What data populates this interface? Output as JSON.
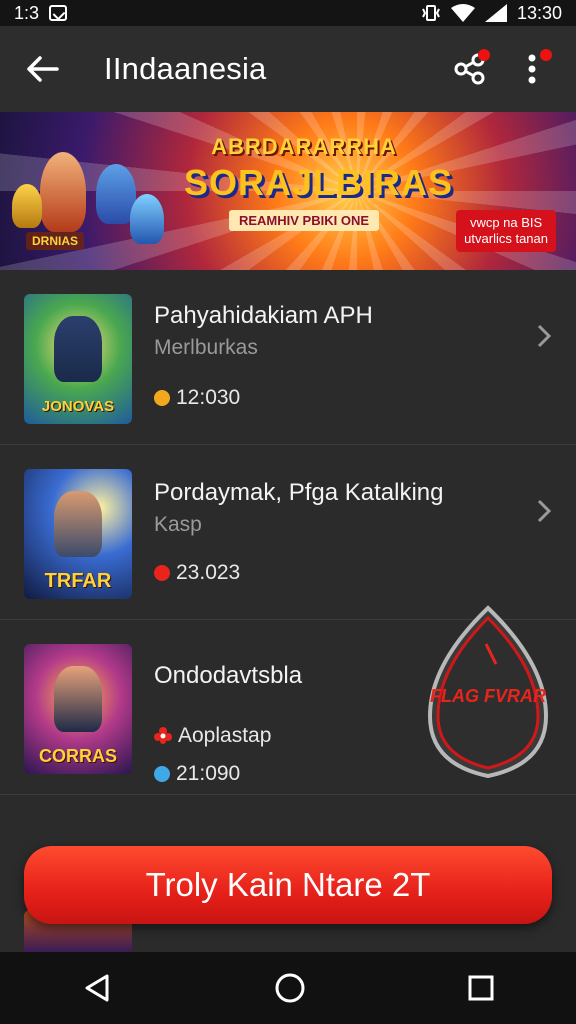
{
  "status_bar": {
    "time_left": "1:3",
    "time_right": "13:30"
  },
  "app_bar": {
    "title": "IIndaanesia",
    "icons": [
      "back-arrow-icon",
      "share-icon",
      "more-vert-icon"
    ]
  },
  "banner": {
    "line1": "ABRDARARRHA",
    "line2": "SORAJLBIRAS",
    "ribbon": "REAMHIV PBIKI ONE",
    "stamp": "DRNIAS",
    "tag_line1": "vwcp na BIS",
    "tag_line2": "utvarlics tanan"
  },
  "list": {
    "items": [
      {
        "title": "Pahyahidakiam APH",
        "subtitle": "Merlburkas",
        "meta": "12:030",
        "dot_color": "#f2a81d",
        "thumb_label": "JONOVAS"
      },
      {
        "title": "Pordaymak, Pfga Katalking",
        "subtitle": "Kasp",
        "meta": "23.023",
        "dot_color": "#e8241d",
        "thumb_label": "TRFAR"
      },
      {
        "title": "Ondodavtsbla",
        "subtitle": "Aoplastap",
        "meta": "21:090",
        "dot_color": "#3fa9e8",
        "thumb_label": "CORRAS"
      }
    ]
  },
  "floating_badge": {
    "label": "FLAG FVRAR"
  },
  "cta": {
    "label": "Troly Kain Ntare 2T"
  },
  "colors": {
    "accent": "#e6201a",
    "background": "#2b2b2b"
  }
}
